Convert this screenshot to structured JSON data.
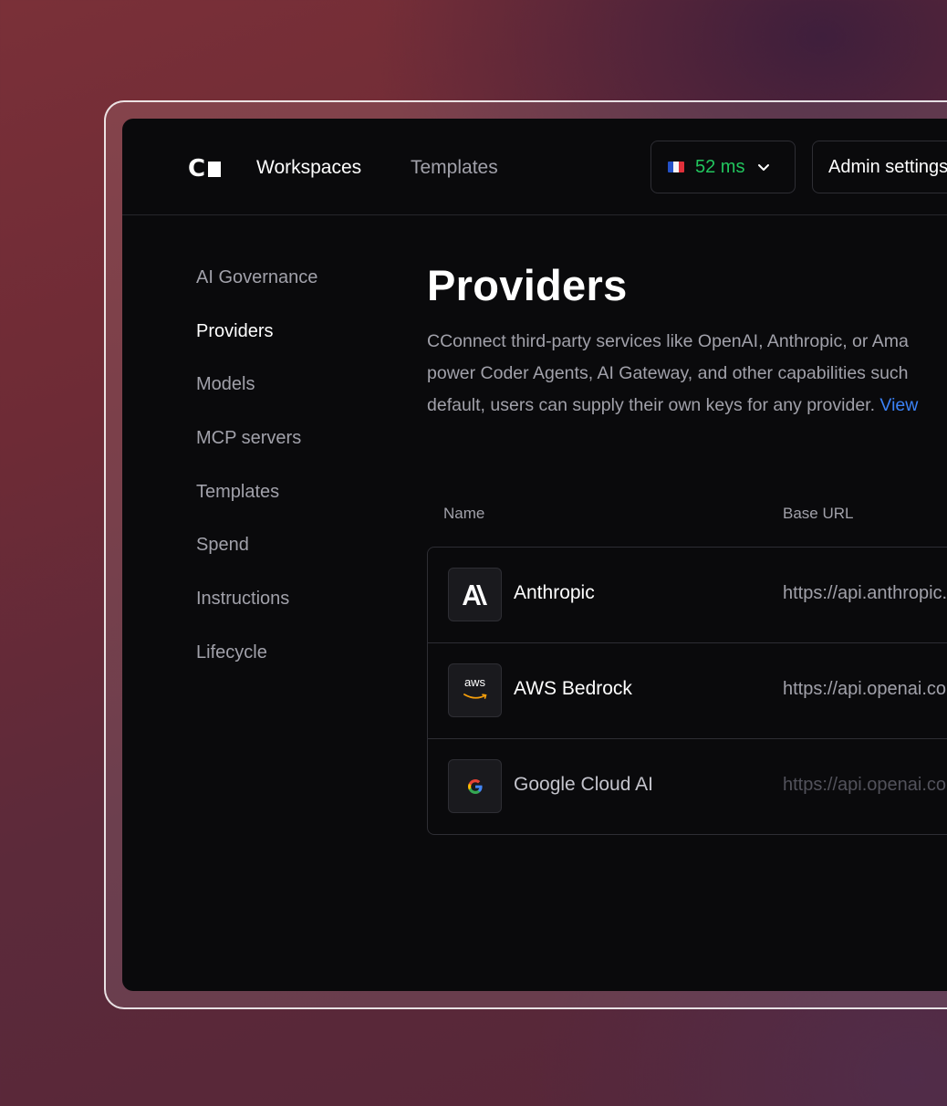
{
  "header": {
    "nav": {
      "workspaces": "Workspaces",
      "templates": "Templates"
    },
    "latency": {
      "value": "52 ms",
      "color": "#22c55e",
      "flag_icon": "france-flag-icon"
    },
    "admin_button": "Admin settings"
  },
  "sidebar": {
    "items": [
      {
        "label": "AI Governance",
        "active": false
      },
      {
        "label": "Providers",
        "active": true
      },
      {
        "label": "Models",
        "active": false
      },
      {
        "label": "MCP servers",
        "active": false
      },
      {
        "label": "Templates",
        "active": false
      },
      {
        "label": "Spend",
        "active": false
      },
      {
        "label": "Instructions",
        "active": false
      },
      {
        "label": "Lifecycle",
        "active": false
      }
    ]
  },
  "main": {
    "title": "Providers",
    "description": {
      "line1": "CConnect third-party services like OpenAI, Anthropic, or Ama",
      "line2": "power Coder Agents, AI Gateway, and other capabilities such",
      "line3": "default, users can supply their own keys for any provider. ",
      "link": "View"
    },
    "table": {
      "headers": {
        "name": "Name",
        "base_url": "Base URL"
      },
      "rows": [
        {
          "name": "Anthropic",
          "url": "https://api.anthropic.com",
          "icon": "anthropic-icon"
        },
        {
          "name": "AWS Bedrock",
          "url": "https://api.openai.com",
          "icon": "aws-icon",
          "icon_text": "aws"
        },
        {
          "name": "Google Cloud AI",
          "url": "https://api.openai.com",
          "icon": "google-icon",
          "icon_text": "G"
        }
      ]
    }
  }
}
